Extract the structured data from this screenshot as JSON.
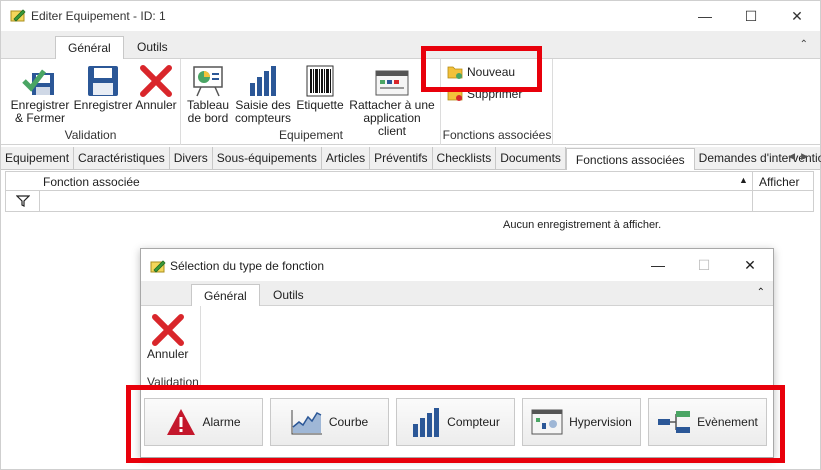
{
  "window": {
    "title": "Editer Equipement - ID: 1",
    "controls": [
      "—",
      "☐",
      "✕"
    ]
  },
  "ribbon": {
    "tabs": [
      "Général",
      "Outils"
    ],
    "collapse": "⌃",
    "groups": {
      "validation": {
        "label": "Validation",
        "buttons": [
          "Enregistrer & Fermer",
          "Enregistrer",
          "Annuler"
        ]
      },
      "equipement": {
        "label": "Equipement",
        "buttons": [
          "Tableau de bord",
          "Saisie des compteurs",
          "Etiquette",
          "Rattacher à une application client"
        ]
      },
      "fonctions": {
        "label": "Fonctions associées",
        "buttons": [
          "Nouveau",
          "Supprimer"
        ]
      }
    }
  },
  "page_tabs": [
    "Equipement",
    "Caractéristiques",
    "Divers",
    "Sous-équipements",
    "Articles",
    "Préventifs",
    "Checklists",
    "Documents",
    "Fonctions associées",
    "Demandes d'intervention"
  ],
  "page_tabs_active": "Fonctions associées",
  "grid": {
    "columns": [
      "Fonction associée",
      "Afficher"
    ],
    "sort_indicator": "▲",
    "empty_message": "Aucun enregistrement à afficher."
  },
  "dialog": {
    "title": "Sélection du type de fonction",
    "controls": [
      "—",
      "☐",
      "✕"
    ],
    "tabs": [
      "Général",
      "Outils"
    ],
    "collapse": "⌃",
    "cancel_label": "Annuler",
    "group_label": "Validation",
    "function_buttons": [
      "Alarme",
      "Courbe",
      "Compteur",
      "Hypervision",
      "Evènement"
    ]
  },
  "colors": {
    "highlight": "#e8000b",
    "icon_blue": "#2b5797",
    "icon_red": "#d9262b",
    "icon_green": "#4aa564"
  }
}
